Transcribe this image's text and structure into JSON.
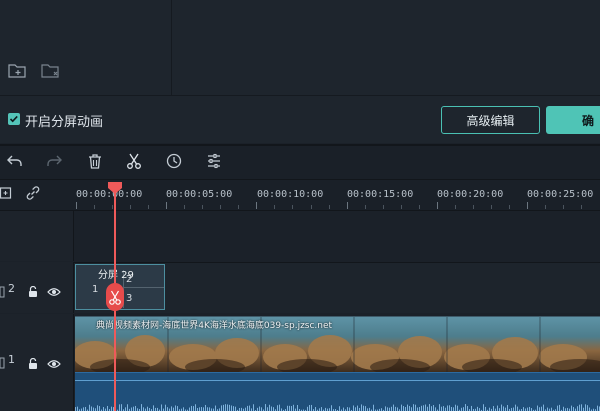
{
  "options": {
    "checkbox_label": "开启分屏动画",
    "advanced_edit_button": "高级编辑",
    "confirm_button": "确定",
    "confirm_button_visible": "确"
  },
  "toolbar": {
    "tools": [
      "undo-icon",
      "redo-icon",
      "delete-icon",
      "cut-icon",
      "speed-icon",
      "adjust-icon"
    ]
  },
  "ruler": {
    "labels": [
      "00:00:00:00",
      "00:00:05:00",
      "00:00:10:00",
      "00:00:15:00",
      "00:00:20:00",
      "00:00:25:00"
    ]
  },
  "tracks": {
    "track2": {
      "number": "2"
    },
    "track1": {
      "number": "1"
    }
  },
  "split_clip": {
    "name": "分屏 29",
    "cell_1": "1",
    "cell_2": "2",
    "cell_3": "3"
  },
  "video_clip": {
    "title": "典尚视频素材网-海底世界4K海洋水底海底039-sp.jzsc.net"
  },
  "colors": {
    "accent": "#4fc4b6",
    "playhead": "#ef5a5a",
    "audio": "#1f4f7a"
  }
}
